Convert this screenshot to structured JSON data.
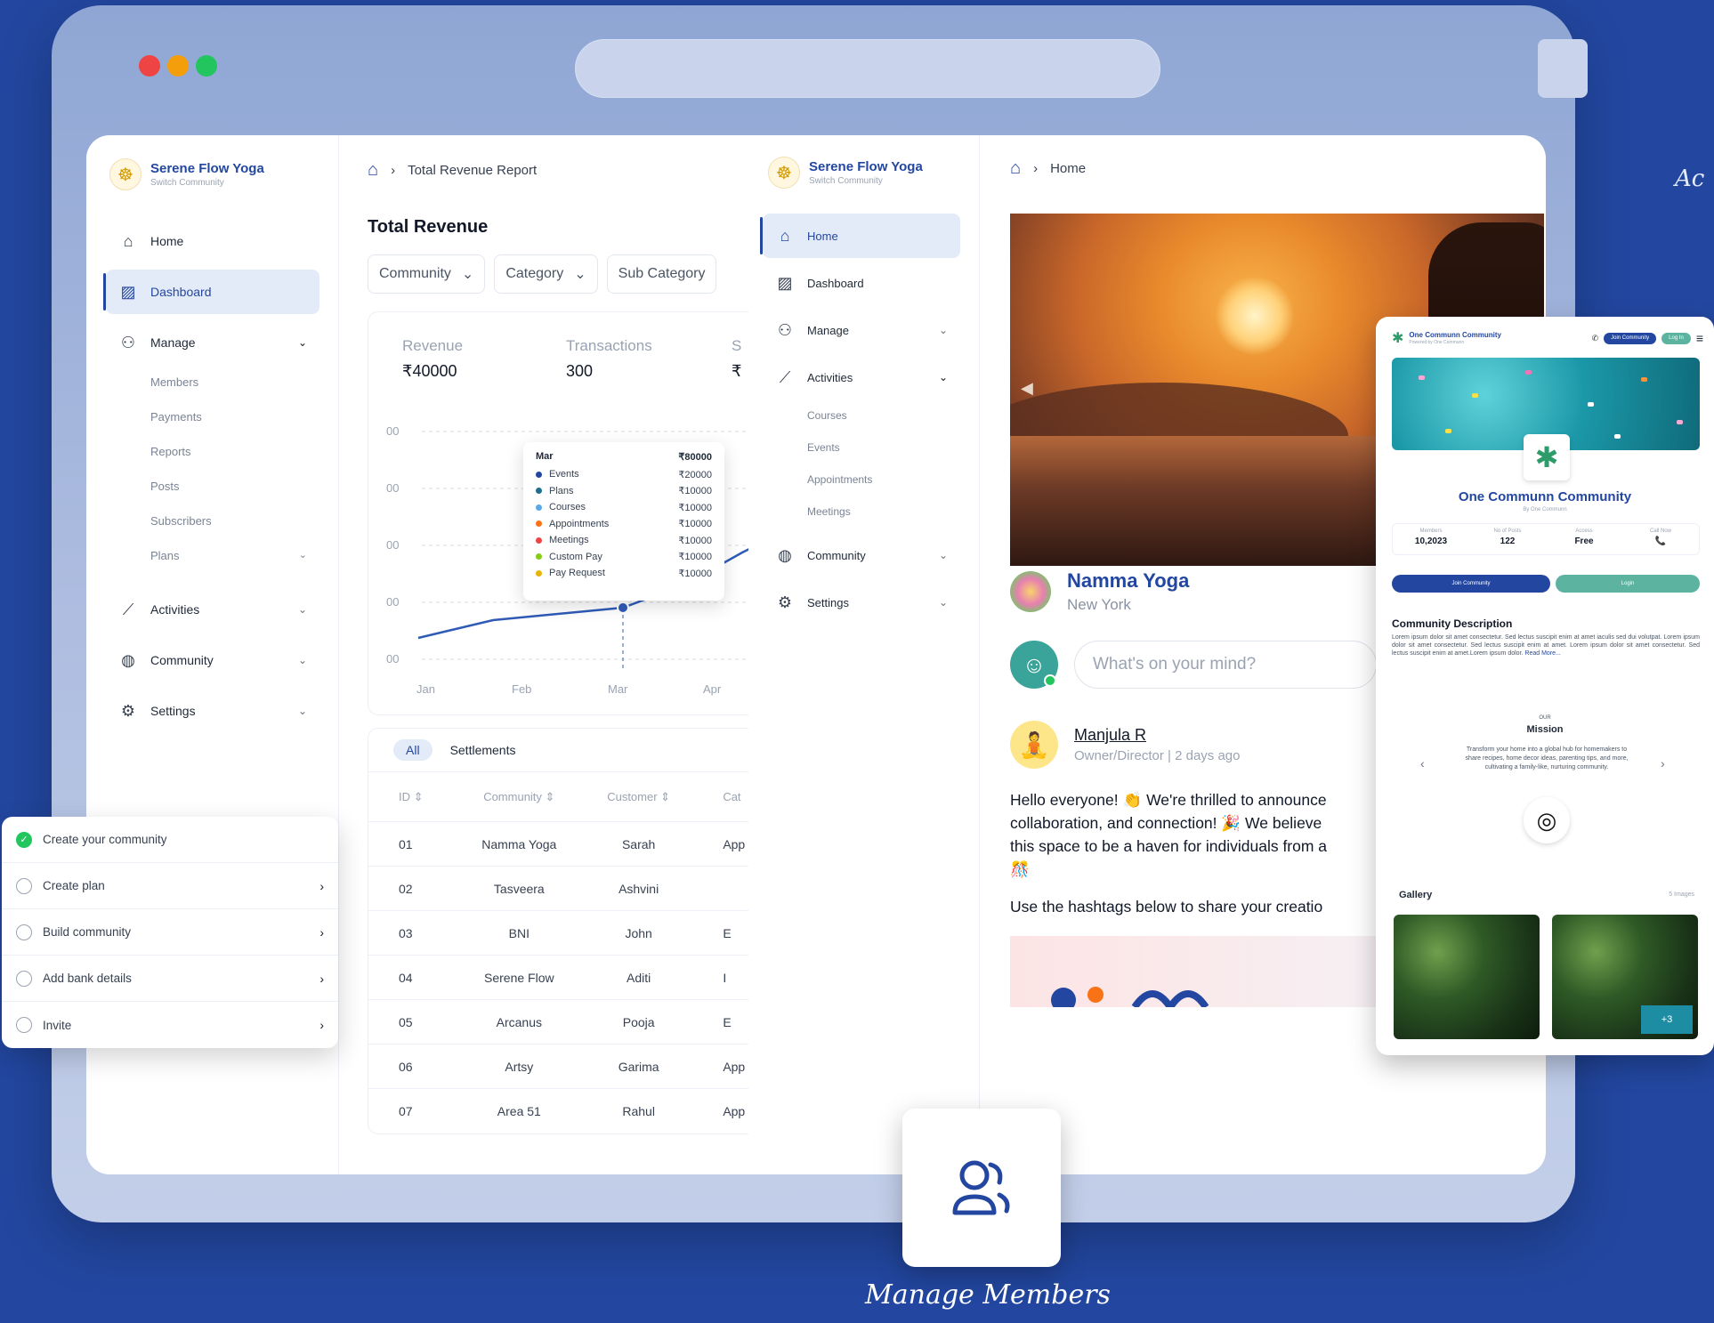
{
  "right_edge_text": "Ac",
  "caption": "Manage Members",
  "sidebar": {
    "brand_name": "Serene Flow Yoga",
    "brand_sub": "Switch Community",
    "items": [
      {
        "label": "Home"
      },
      {
        "label": "Dashboard"
      },
      {
        "label": "Manage"
      },
      {
        "label": "Activities"
      },
      {
        "label": "Community"
      },
      {
        "label": "Settings"
      }
    ],
    "manage_sub": [
      "Members",
      "Payments",
      "Reports",
      "Posts",
      "Subscribers",
      "Plans"
    ]
  },
  "checklist": [
    {
      "label": "Create your community",
      "done": true
    },
    {
      "label": "Create plan"
    },
    {
      "label": "Build community"
    },
    {
      "label": "Add bank details"
    },
    {
      "label": "Invite"
    }
  ],
  "revenue": {
    "breadcrumb": "Total Revenue Report",
    "title": "Total Revenue",
    "filters": [
      "Community",
      "Category",
      "Sub Category"
    ],
    "kpis": [
      {
        "label": "Revenue",
        "value": "₹40000"
      },
      {
        "label": "Transactions",
        "value": "300"
      },
      {
        "label": "S",
        "value": "₹"
      }
    ],
    "y_labels": [
      "00",
      "00",
      "00",
      "00",
      "00"
    ],
    "x_labels": [
      "Jan",
      "Feb",
      "Mar",
      "Apr"
    ],
    "tooltip": {
      "month": "Mar",
      "total": "₹80000",
      "rows": [
        {
          "name": "Events",
          "value": "₹20000",
          "color": "#2347a0"
        },
        {
          "name": "Plans",
          "value": "₹10000",
          "color": "#1f6f8b"
        },
        {
          "name": "Courses",
          "value": "₹10000",
          "color": "#5aa9e6"
        },
        {
          "name": "Appointments",
          "value": "₹10000",
          "color": "#f97316"
        },
        {
          "name": "Meetings",
          "value": "₹10000",
          "color": "#ef4444"
        },
        {
          "name": "Custom Pay",
          "value": "₹10000",
          "color": "#84cc16"
        },
        {
          "name": "Pay Request",
          "value": "₹10000",
          "color": "#eab308"
        }
      ]
    },
    "tabs": [
      "All",
      "Settlements"
    ],
    "table": {
      "headers": [
        "ID ⇕",
        "Community ⇕",
        "Customer ⇕",
        "Cat"
      ],
      "rows": [
        [
          "01",
          "Namma Yoga",
          "Sarah",
          "App"
        ],
        [
          "02",
          "Tasveera",
          "Ashvini",
          ""
        ],
        [
          "03",
          "BNI",
          "John",
          "E"
        ],
        [
          "04",
          "Serene Flow",
          "Aditi",
          "I"
        ],
        [
          "05",
          "Arcanus",
          "Pooja",
          "E"
        ],
        [
          "06",
          "Artsy",
          "Garima",
          "App"
        ],
        [
          "07",
          "Area 51",
          "Rahul",
          "App"
        ]
      ]
    }
  },
  "sidebar2": {
    "brand_name": "Serene Flow Yoga",
    "brand_sub": "Switch Community",
    "items": [
      {
        "label": "Home"
      },
      {
        "label": "Dashboard"
      },
      {
        "label": "Manage"
      },
      {
        "label": "Activities"
      },
      {
        "label": "Community"
      },
      {
        "label": "Settings"
      }
    ],
    "activities_sub": [
      "Courses",
      "Events",
      "Appointments",
      "Meetings"
    ]
  },
  "home": {
    "breadcrumb": "Home",
    "community_name": "Namma Yoga",
    "community_location": "New York",
    "composer_placeholder": "What's on your mind?",
    "author": "Manjula R",
    "author_meta": "Owner/Director | 2 days ago",
    "post_line1": "Hello everyone! 👏 We're thrilled to announce",
    "post_line2": "collaboration, and connection! 🎉 We believe",
    "post_line3": "this space to be a haven for individuals from a",
    "post_line4": "🎊",
    "post_line5": "Use the hashtags below to share your creatio"
  },
  "mobile": {
    "brand": "One Communn Community",
    "brand_sub": "Powered by One Communn",
    "join_btn": "Join Community",
    "login_btn": "Log In",
    "name": "One Communn Community",
    "by": "By One Communn",
    "stats": [
      {
        "label": "Members",
        "value": "10,2023"
      },
      {
        "label": "No of Posts",
        "value": "122"
      },
      {
        "label": "Access",
        "value": "Free"
      },
      {
        "label": "Call Now",
        "value": "📞"
      }
    ],
    "join_full": "Join Community",
    "login_full": "Login",
    "desc_title": "Community Description",
    "desc": "Lorem ipsum dolor sit amet consectetur. Sed lectus suscipit enim at amet iaculis sed dui volutpat. Lorem ipsum dolor sit amet consectetur. Sed lectus suscipit enim at amet. Lorem ipsum dolor sit amet consectetur. Sed lectus suscipit enim at amet.Lorem ipsum dolor.",
    "read_more": "Read More...",
    "our": "OUR",
    "mission": "Mission",
    "mission_text": "Transform your home into a global hub for homemakers to share recipes, home decor ideas, parenting tips, and more, cultivating a family-like, nurturing community.",
    "gallery": "Gallery",
    "gallery_count": "5 Images",
    "more": "+3"
  }
}
